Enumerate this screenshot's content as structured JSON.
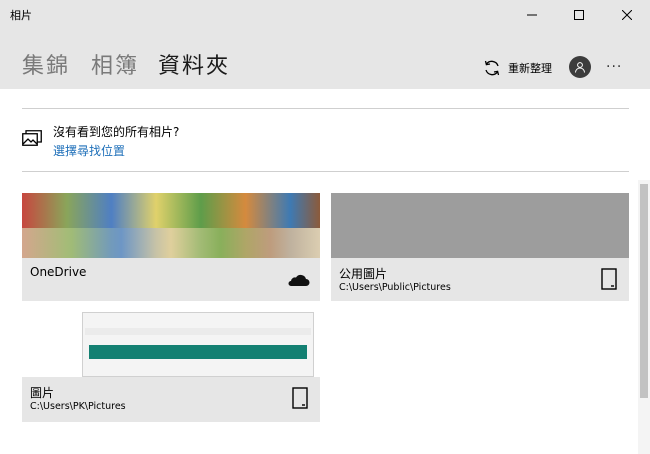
{
  "window": {
    "title": "相片",
    "icons": {
      "minimize": "minimize-icon",
      "maximize": "maximize-icon",
      "close": "close-icon"
    }
  },
  "nav": {
    "tabs": [
      {
        "label": "集錦",
        "active": false
      },
      {
        "label": "相簿",
        "active": false
      },
      {
        "label": "資料夾",
        "active": true
      }
    ],
    "refresh_label": "重新整理",
    "refresh_icon": "refresh-icon",
    "account_icon": "user-icon",
    "more_label": "···"
  },
  "notice": {
    "text": "沒有看到您的所有相片?",
    "link": "選擇尋找位置",
    "icon": "images-icon"
  },
  "folders": [
    {
      "name": "OneDrive",
      "path": "",
      "icon": "cloud-icon"
    },
    {
      "name": "公用圖片",
      "path": "C:\\Users\\Public\\Pictures",
      "icon": "device-icon"
    },
    {
      "name": "圖片",
      "path": "C:\\Users\\PK\\Pictures",
      "icon": "device-icon"
    }
  ],
  "colors": {
    "chrome": "#e6e6e6",
    "link": "#1e6fb9",
    "accent_bar": "#138072"
  }
}
